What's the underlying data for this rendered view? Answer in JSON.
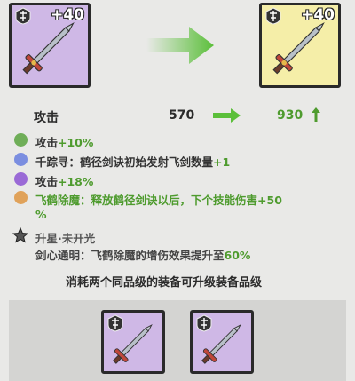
{
  "cards": {
    "current": {
      "level_bonus": "+40",
      "rarity_color": "#cfb8e6"
    },
    "upgraded": {
      "level_bonus": "+40",
      "rarity_color": "#f5eea8"
    }
  },
  "stat": {
    "label": "攻击",
    "current_value": "570",
    "new_value": "930",
    "arrow_color": "#5bbf3a"
  },
  "attributes": [
    {
      "dot_color": "#6fae58",
      "label": "攻击",
      "value": "+10%"
    },
    {
      "dot_color": "#7b8ee0",
      "label": "千踪寻：",
      "text": "鹤径剑诀初始发射飞剑数量",
      "value": "+1"
    },
    {
      "dot_color": "#9a6ad6",
      "label": "攻击",
      "value": "+18%"
    },
    {
      "dot_color": "#e0a25a",
      "label": "飞鹤除魔：",
      "text": "释放鹤径剑诀以后，下个技能伤害",
      "value": "+50",
      "value_wrap": "%"
    }
  ],
  "star": {
    "icon": "star-icon",
    "title": "升星·未开光",
    "label": "剑心通明：",
    "text": "飞鹤除魔的增伤效果提升至",
    "value": "60%"
  },
  "consume_text": "消耗两个同品级的装备可升级装备品级",
  "materials": [
    {
      "rarity_color": "#cfb8e6"
    },
    {
      "rarity_color": "#cfb8e6"
    }
  ]
}
